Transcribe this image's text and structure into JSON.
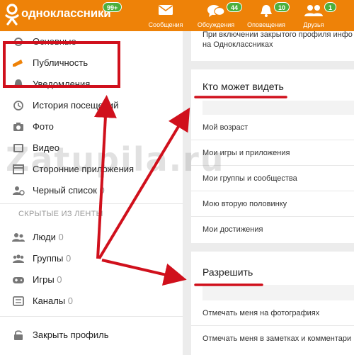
{
  "header": {
    "brand": "одноклассники",
    "brand_badge": "99+",
    "nav": [
      {
        "label": "Сообщения",
        "badge": "",
        "icon": "envelope-icon"
      },
      {
        "label": "Обсуждения",
        "badge": "44",
        "icon": "chat-bubbles-icon"
      },
      {
        "label": "Оповещения",
        "badge": "10",
        "icon": "bell-icon"
      },
      {
        "label": "Друзья",
        "badge": "1",
        "icon": "friends-icon"
      }
    ]
  },
  "sidebar": {
    "items": [
      {
        "label": "Основные",
        "count": "",
        "icon": "settings-icon"
      },
      {
        "label": "Публичность",
        "count": "",
        "icon": "megaphone-icon",
        "active": true
      },
      {
        "label": "Уведомления",
        "count": "",
        "icon": "bell-icon"
      },
      {
        "label": "История посещений",
        "count": "",
        "icon": "history-icon"
      },
      {
        "label": "Фото",
        "count": "",
        "icon": "camera-icon"
      },
      {
        "label": "Видео",
        "count": "",
        "icon": "video-icon"
      },
      {
        "label": "Сторонние приложения",
        "count": "",
        "icon": "apps-icon"
      },
      {
        "label": "Черный список",
        "count": "0",
        "icon": "blocked-user-icon"
      }
    ],
    "hidden_section_title": "СКРЫТЫЕ ИЗ ЛЕНТЫ",
    "hidden_items": [
      {
        "label": "Люди",
        "count": "0",
        "icon": "people-icon"
      },
      {
        "label": "Группы",
        "count": "0",
        "icon": "groups-icon"
      },
      {
        "label": "Игры",
        "count": "0",
        "icon": "gamepad-icon"
      },
      {
        "label": "Каналы",
        "count": "0",
        "icon": "channels-icon"
      }
    ],
    "close_profile": {
      "label": "Закрыть профиль",
      "icon": "lock-icon"
    }
  },
  "main": {
    "intro_lines": [
      "При включении закрытого профиля инфо",
      "на Одноклассниках"
    ],
    "who_can_see": {
      "title": "Кто может видеть",
      "rows": [
        "Мой возраст",
        "Мои игры и приложения",
        "Мои группы и сообщества",
        "Мою вторую половинку",
        "Мои достижения"
      ]
    },
    "allow": {
      "title": "Разрешить",
      "rows": [
        "Отмечать меня на фотографиях",
        "Отмечать меня в заметках и комментари"
      ]
    }
  },
  "watermark": "Zatupila.ru",
  "colors": {
    "brand_orange": "#ee8208",
    "badge_green": "#4caf3c",
    "annotation_red": "#d0101c"
  }
}
